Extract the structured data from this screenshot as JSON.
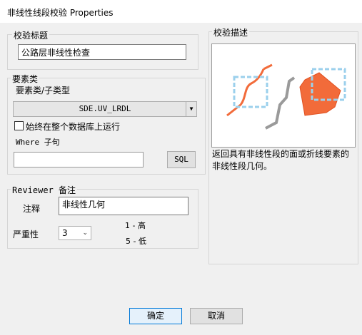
{
  "window": {
    "title": "非线性线段校验 Properties"
  },
  "check_title_group": {
    "label": "校验标题",
    "value": "公路层非线性检查"
  },
  "feature_class_group": {
    "label": "要素类",
    "subtype_label": "要素类/子类型",
    "dropdown_value": "SDE.UV_LRDL",
    "run_all_label": "始终在整个数据库上运行",
    "where_label": "Where 子句",
    "sql_button": "SQL"
  },
  "reviewer_group": {
    "label": "Reviewer 备注",
    "notes_label": "注释",
    "notes_value": "非线性几何",
    "severity_label": "严重性",
    "severity_value": "3",
    "severity_high": "1 - 高",
    "severity_low": "5 - 低"
  },
  "description_group": {
    "label": "校验描述",
    "text": "返回具有非线性段的面或折线要素的非线性段几何。"
  },
  "buttons": {
    "ok": "确定",
    "cancel": "取消"
  },
  "colors": {
    "accent_orange": "#f26b3a",
    "dashed_blue": "#9bd0ec"
  }
}
